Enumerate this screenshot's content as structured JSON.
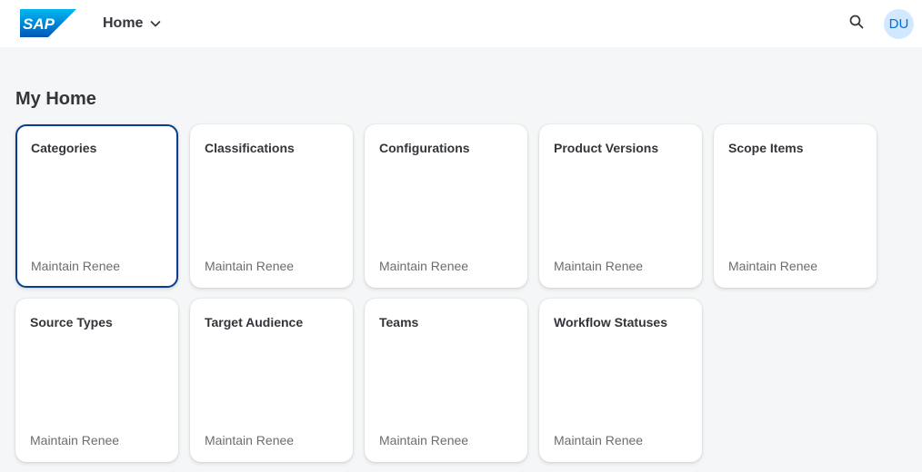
{
  "shellbar": {
    "logo_text": "SAP",
    "home_label": "Home",
    "avatar_initials": "DU",
    "search_icon": "search-icon",
    "colors": {
      "brand_blue": "#0a6ed1",
      "avatar_bg": "#d1e8ff"
    }
  },
  "page": {
    "title": "My Home"
  },
  "tiles": [
    {
      "title": "Categories",
      "subtitle": "Maintain Renee"
    },
    {
      "title": "Classifications",
      "subtitle": "Maintain Renee"
    },
    {
      "title": "Configurations",
      "subtitle": "Maintain Renee"
    },
    {
      "title": "Product Versions",
      "subtitle": "Maintain Renee"
    },
    {
      "title": "Scope Items",
      "subtitle": "Maintain Renee"
    },
    {
      "title": "Source Types",
      "subtitle": "Maintain Renee"
    },
    {
      "title": "Target Audience",
      "subtitle": "Maintain Renee"
    },
    {
      "title": "Teams",
      "subtitle": "Maintain Renee"
    },
    {
      "title": "Workflow Statuses",
      "subtitle": "Maintain Renee"
    }
  ]
}
